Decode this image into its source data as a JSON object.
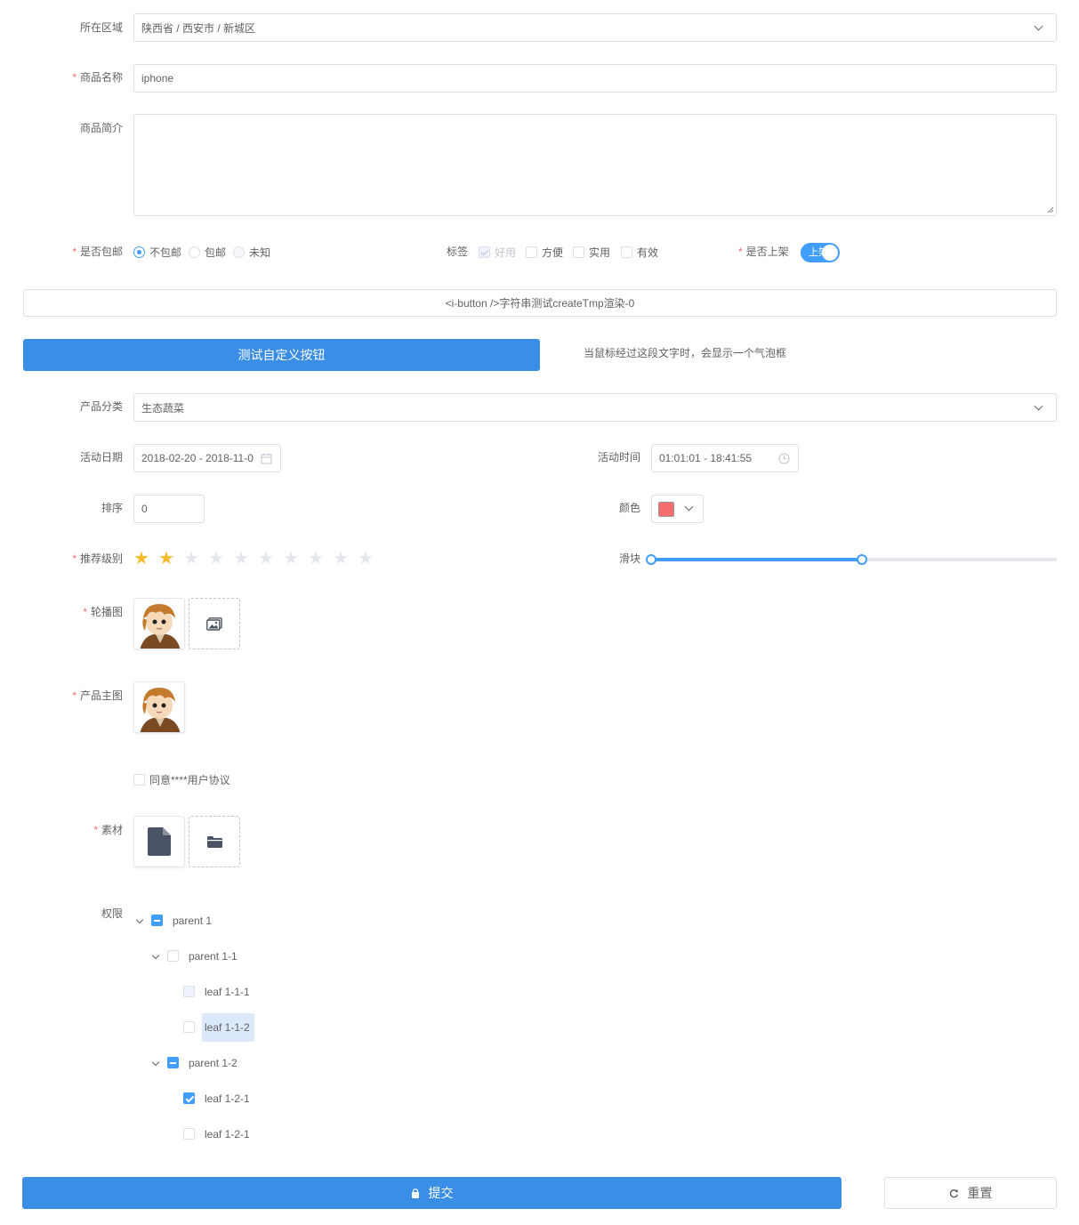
{
  "region": {
    "label": "所在区域",
    "value": "陕西省 / 西安市 / 新城区"
  },
  "product_name": {
    "label": "商品名称",
    "value": "iphone"
  },
  "product_desc": {
    "label": "商品简介",
    "value": ""
  },
  "shipping": {
    "label": "是否包邮",
    "options": [
      "不包邮",
      "包邮",
      "未知"
    ],
    "selected": "不包邮"
  },
  "tags": {
    "label": "标签",
    "options": [
      "好用",
      "方便",
      "实用",
      "有效"
    ]
  },
  "on_shelf": {
    "label": "是否上架",
    "toggle_text": "上架"
  },
  "render_test": {
    "text": "<i-button />字符串测试createTmp渲染-0"
  },
  "custom_button": {
    "label": "测试自定义按钮"
  },
  "tooltip_text": "当鼠标经过这段文字时，会显示一个气泡框",
  "category": {
    "label": "产品分类",
    "value": "生态蔬菜"
  },
  "activity_date": {
    "label": "活动日期",
    "value": "2018-02-20 - 2018-11-0"
  },
  "activity_time": {
    "label": "活动时间",
    "value": "01:01:01 - 18:41:55"
  },
  "sort": {
    "label": "排序",
    "value": "0"
  },
  "color": {
    "label": "颜色",
    "value": "#f56c6c"
  },
  "rating": {
    "label": "推荐级别",
    "value": 2,
    "max": 10
  },
  "slider": {
    "label": "滑块",
    "range": [
      0,
      50
    ]
  },
  "carousel": {
    "label": "轮播图"
  },
  "main_image": {
    "label": "产品主图"
  },
  "agreement": {
    "label": "同意****用户协议"
  },
  "material": {
    "label": "素材"
  },
  "permission": {
    "label": "权限",
    "nodes": [
      {
        "label": "parent 1"
      },
      {
        "label": "parent 1-1"
      },
      {
        "label": "leaf 1-1-1"
      },
      {
        "label": "leaf 1-1-2"
      },
      {
        "label": "parent 1-2"
      },
      {
        "label": "leaf 1-2-1"
      },
      {
        "label": "leaf 1-2-1"
      }
    ]
  },
  "actions": {
    "submit": "提交",
    "reset": "重置"
  },
  "colors": {
    "primary": "#3a8ee6",
    "required": "#f56c6c",
    "star": "#f7ba2a"
  },
  "icons": [
    "chevron-down-icon",
    "calendar-icon",
    "clock-icon",
    "image-icon",
    "file-icon",
    "folder-icon",
    "lock-icon",
    "refresh-icon"
  ]
}
